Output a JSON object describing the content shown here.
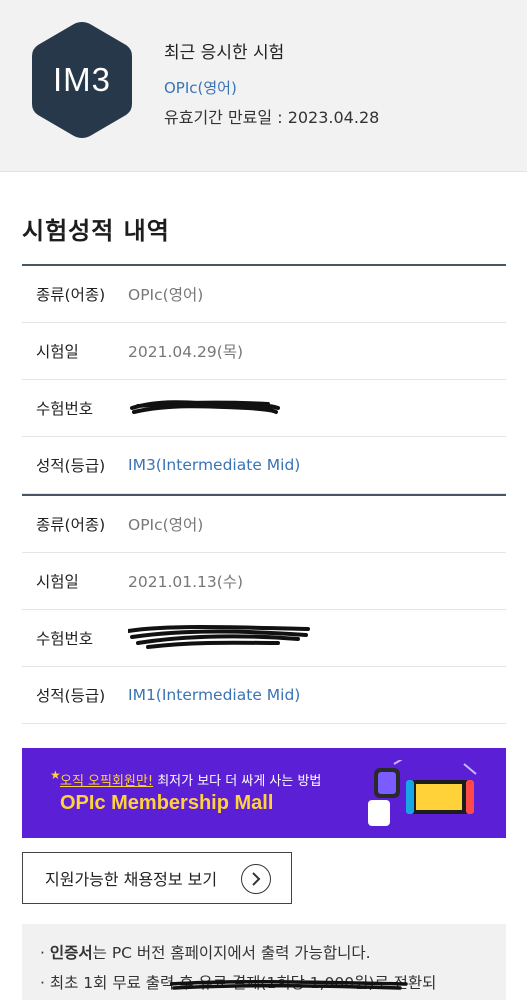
{
  "profile": {
    "badge": "IM3",
    "title": "최근 응시한 시험",
    "exam": "OPIc(영어)",
    "expiry": "유효기간 만료일 : 2023.04.28"
  },
  "section_title": "시험성적 내역",
  "records": [
    {
      "type_label": "종류(어종)",
      "type_value": "OPIc(영어)",
      "date_label": "시험일",
      "date_value": "2021.04.29(목)",
      "number_label": "수험번호",
      "grade_label": "성적(등급)",
      "grade_value": "IM3(Intermediate Mid)"
    },
    {
      "type_label": "종류(어종)",
      "type_value": "OPIc(영어)",
      "date_label": "시험일",
      "date_value": "2021.01.13(수)",
      "number_label": "수험번호",
      "grade_label": "성적(등급)",
      "grade_value": "IM1(Intermediate Mid)"
    }
  ],
  "banner": {
    "line1_highlight": "오직 오픽회원만!",
    "line1_rest": " 최저가 보다 더 싸게 사는 방법",
    "line2": "OPIc Membership Mall",
    "bg_color": "#5b1fd6",
    "accent_color": "#ffd23a"
  },
  "jobs_button": "지원가능한 채용정보 보기",
  "notice": {
    "line1_bold": "인증서",
    "line1_rest": "는 PC 버전 홈페이지에서 출력 가능합니다.",
    "line2": "최초 1회 무료 출력 후 유료 결제(1회당 1,000원)로 전환되"
  },
  "colors": {
    "accent": "#3a74b5",
    "badge": "#27384b"
  }
}
